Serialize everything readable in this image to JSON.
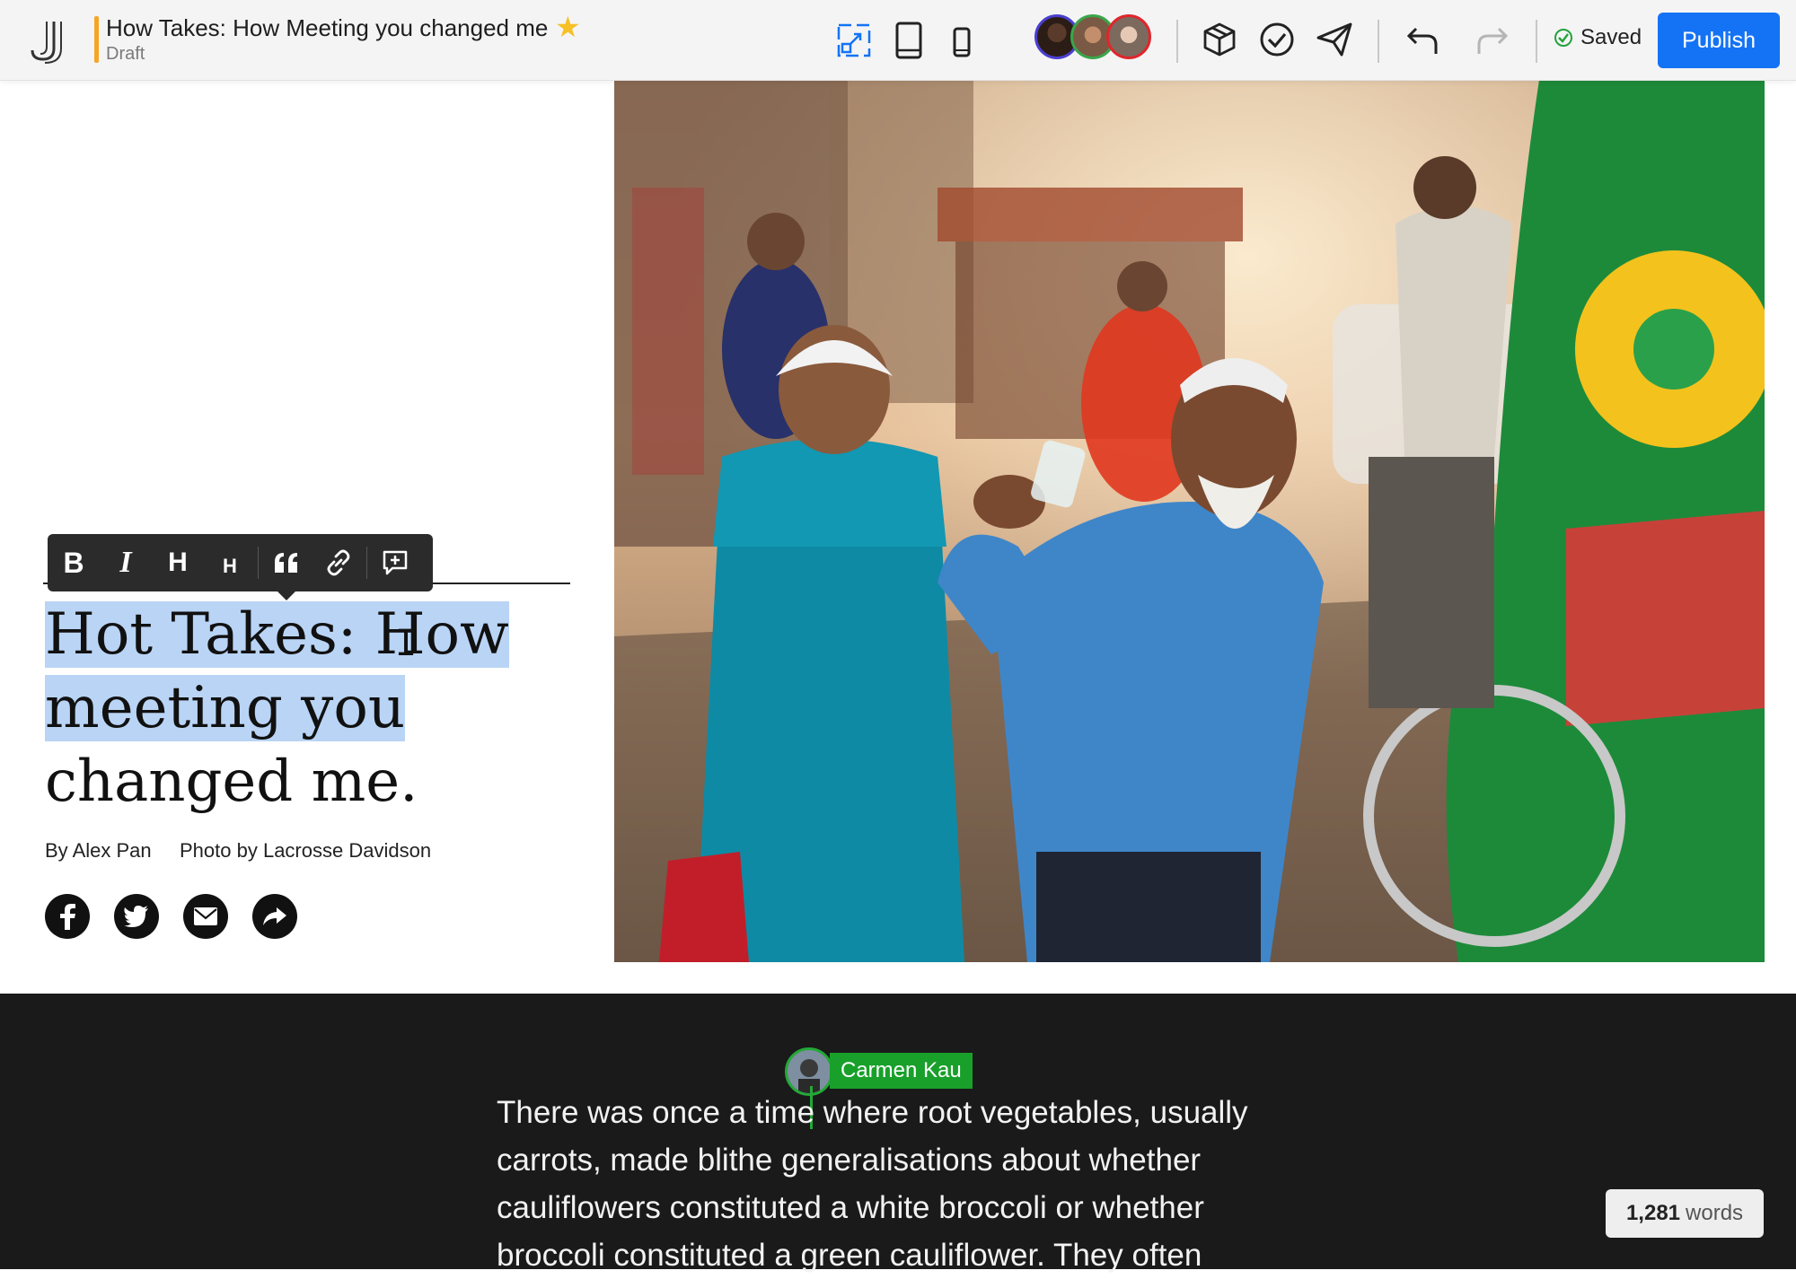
{
  "document": {
    "title": "How Takes: How Meeting you changed me",
    "status": "Draft"
  },
  "topbar": {
    "saved_label": "Saved",
    "publish_label": "Publish",
    "icons": [
      "logo",
      "star-icon",
      "fullscreen-preview-icon",
      "tablet-preview-icon",
      "phone-preview-icon",
      "package-icon",
      "check-circle-icon",
      "send-icon",
      "undo-icon",
      "redo-icon",
      "saved-check-icon"
    ]
  },
  "collaborators": [
    "collaborator-1",
    "collaborator-2",
    "collaborator-3"
  ],
  "format_toolbar": {
    "buttons": [
      "bold",
      "italic",
      "heading-large",
      "heading-small",
      "blockquote",
      "link",
      "add-comment"
    ],
    "labels": {
      "bold": "B",
      "italic": "I",
      "heading_large": "H",
      "heading_small": "H"
    }
  },
  "article": {
    "headline_line1_selected": "Hot Takes: How",
    "headline_line2_selected": "meeting you",
    "headline_line3": "changed me.",
    "byline": "By Alex Pan",
    "photo_credit": "Photo by Lacrosse Davidson",
    "share_icons": [
      "facebook-icon",
      "twitter-icon",
      "email-icon",
      "share-icon"
    ],
    "body": "There was once a time where root vegetables, usually carrots, made blithe generalisations about whether cauliflowers constituted a white broccoli or whether broccoli constituted a green cauliflower. They often"
  },
  "presence": {
    "name": "Carmen Kau",
    "color": "#18a02a"
  },
  "word_count": {
    "value": "1,281",
    "label": "words"
  },
  "colors": {
    "accent": "#1473f5",
    "draft_marker": "#f5a623",
    "selection": "#b9d4f5",
    "dark_background": "#1a1a1a"
  }
}
